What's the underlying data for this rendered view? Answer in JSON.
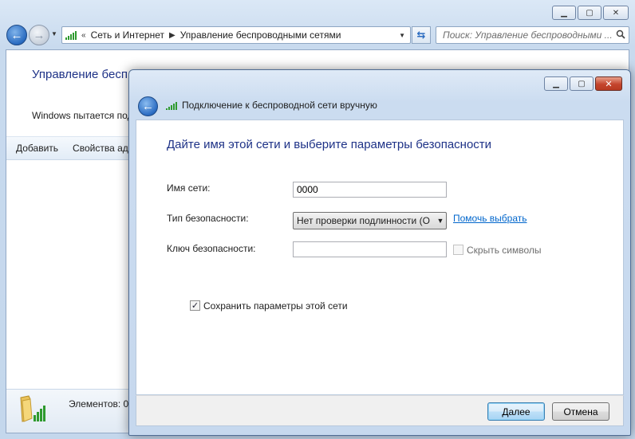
{
  "explorer": {
    "breadcrumb": [
      "Сеть и Интернет",
      "Управление беспроводными сетями"
    ],
    "search_placeholder": "Поиск: Управление беспроводными ...",
    "page_title": "Управление бесп",
    "description": "Windows пытается под",
    "toolbar": {
      "add_label": "Добавить",
      "adapter_props_label": "Свойства ада"
    },
    "status": {
      "items_label": "Элементов: 0"
    }
  },
  "dialog": {
    "title": "Подключение к беспроводной сети вручную",
    "instruction": "Дайте имя этой сети и выберите параметры безопасности",
    "fields": {
      "network_name_label": "Имя сети:",
      "network_name_value": "0000",
      "security_type_label": "Тип безопасности:",
      "security_type_value": "Нет проверки подлинности (О",
      "help_link": "Помочь выбрать",
      "security_key_label": "Ключ безопасности:",
      "security_key_value": "",
      "hide_chars_label": "Скрыть символы",
      "hide_chars_checked": false,
      "save_settings_label": "Сохранить параметры этой сети",
      "save_settings_checked": true
    },
    "buttons": {
      "next_label": "Далее",
      "cancel_label": "Отмена"
    }
  },
  "icons": {
    "back": "back-arrow-icon",
    "forward": "forward-arrow-icon",
    "signal": "wireless-signal-icon",
    "refresh": "refresh-icon",
    "search": "search-icon",
    "folder": "network-folder-icon",
    "minimize": "minimize-icon",
    "maximize": "maximize-icon",
    "close": "close-icon"
  },
  "colors": {
    "instruction_blue": "#1e3287",
    "link_blue": "#0066cc",
    "signal_green": "#2e9a2e"
  }
}
